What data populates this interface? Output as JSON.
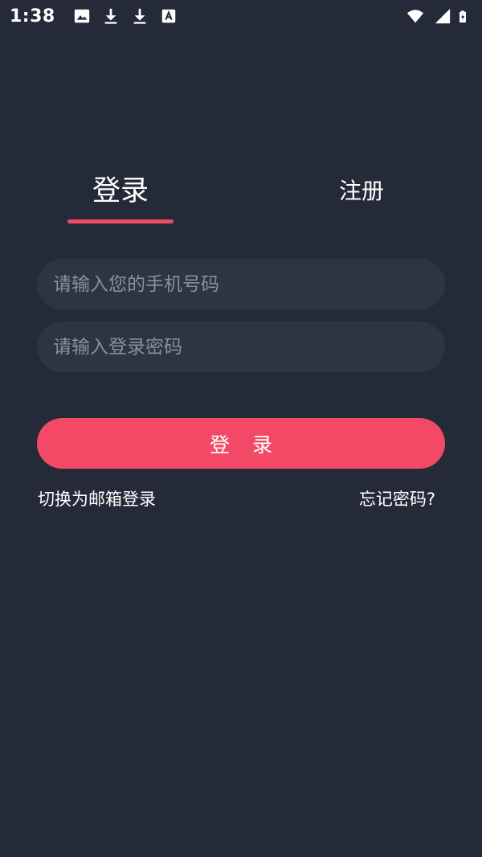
{
  "status_bar": {
    "time": "1:38",
    "icons_left": [
      "image-icon",
      "download-icon",
      "download-icon",
      "font-a-icon"
    ],
    "icons_right": [
      "wifi-icon",
      "signal-icon",
      "battery-charging-icon"
    ]
  },
  "tabs": {
    "login_label": "登录",
    "register_label": "注册",
    "active": "login"
  },
  "form": {
    "phone_placeholder": "请输入您的手机号码",
    "phone_value": "",
    "password_placeholder": "请输入登录密码",
    "password_value": "",
    "login_button_label": "登 录"
  },
  "links": {
    "switch_email": "切换为邮箱登录",
    "forgot_password": "忘记密码?"
  },
  "colors": {
    "background": "#252a39",
    "input_background": "#2f3442",
    "accent": "#f24a66",
    "placeholder": "#8a8f9e",
    "text": "#ffffff"
  }
}
